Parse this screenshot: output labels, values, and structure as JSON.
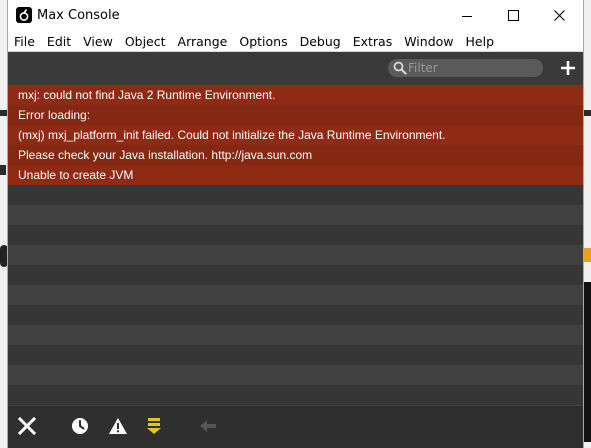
{
  "window": {
    "title": "Max Console"
  },
  "menu": {
    "items": [
      "File",
      "Edit",
      "View",
      "Object",
      "Arrange",
      "Options",
      "Debug",
      "Extras",
      "Window",
      "Help"
    ]
  },
  "toolbar": {
    "filter_placeholder": "Filter",
    "filter_value": ""
  },
  "console": {
    "messages": [
      {
        "text": "mxj: could not find Java 2 Runtime Environment.",
        "level": "error"
      },
      {
        "text": "Error loading:",
        "level": "error"
      },
      {
        "text": "(mxj) mxj_platform_init failed. Could not initialize the Java Runtime Environment.",
        "level": "error"
      },
      {
        "text": "Please check your Java installation.  http://java.sun.com",
        "level": "error"
      },
      {
        "text": "Unable to create JVM",
        "level": "error"
      }
    ]
  },
  "bottom_toolbar": {
    "icons": [
      "clear-icon",
      "clock-icon",
      "warning-icon",
      "scroll-to-bottom-icon",
      "back-arrow-icon"
    ]
  },
  "colors": {
    "error_row": "#8f2a14",
    "console_bg": "#3a3a3a",
    "accent_yellow": "#e6c619"
  }
}
